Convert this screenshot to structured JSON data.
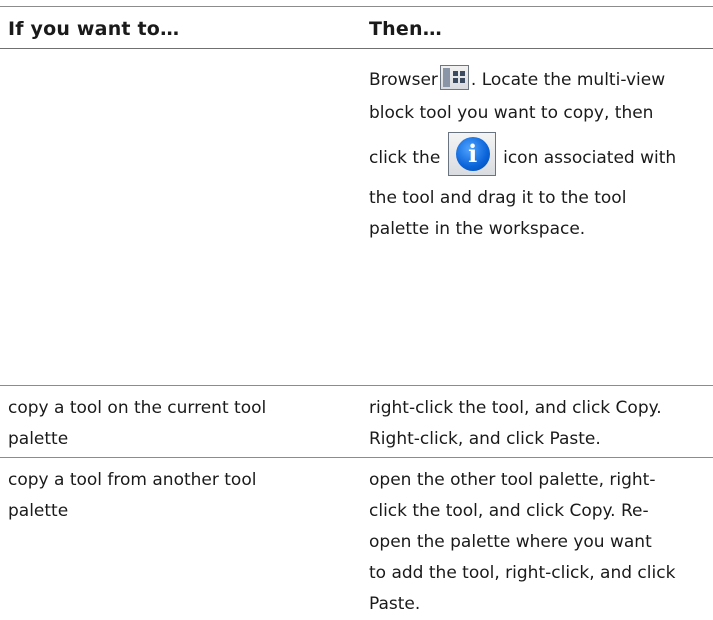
{
  "table": {
    "headers": {
      "col1": "If you want to…",
      "col2": "Then…"
    },
    "rows": [
      {
        "col1": "",
        "col2_lines": {
          "l1_before": "Browser",
          "l1_after": ". Locate the multi-view",
          "l2": "block tool you want to copy, then",
          "l3_before": "click the",
          "l3_after": "icon associated with",
          "l4": "the tool and drag it to the tool",
          "l5": "palette in the workspace."
        },
        "icons": [
          "content-browser-icon",
          "tool-properties-info-icon"
        ]
      },
      {
        "col1_lines": [
          "copy a tool on the current tool",
          "palette"
        ],
        "col2_lines": [
          "right-click the tool, and click Copy.",
          "Right-click, and click Paste."
        ]
      },
      {
        "col1_lines": [
          "copy a tool from another tool",
          "palette"
        ],
        "col2_lines": [
          "open the other tool palette, right-",
          "click the tool, and click Copy. Re-",
          "open the palette where you want",
          "to add the tool, right-click, and click",
          "Paste."
        ]
      }
    ]
  },
  "colors": {
    "rule": "#8c8c8c",
    "text": "#1a1a1a",
    "info_icon_blue": "#0a63d8"
  }
}
